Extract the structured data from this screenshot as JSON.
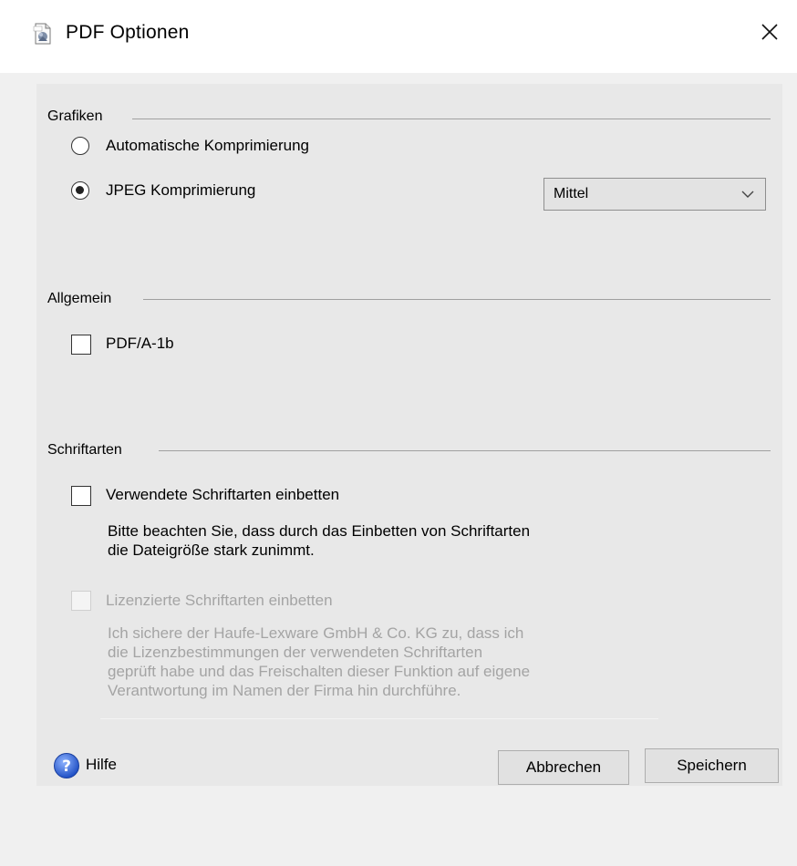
{
  "window": {
    "title": "PDF Optionen",
    "icon": "pdf-document-icon",
    "close_icon": "close-icon"
  },
  "graphics": {
    "title": "Grafiken",
    "options": [
      {
        "label": "Automatische Komprimierung",
        "selected": false
      },
      {
        "label": "JPEG Komprimierung",
        "selected": true
      }
    ],
    "quality_select": {
      "value": "Mittel"
    }
  },
  "general": {
    "title": "Allgemein",
    "pdfa": {
      "label": "PDF/A-1b",
      "checked": false
    }
  },
  "fonts": {
    "title": "Schriftarten",
    "embed": {
      "label": "Verwendete Schriftarten einbetten",
      "checked": false
    },
    "embed_note": [
      "Bitte beachten Sie, dass durch das Einbetten von Schriftarten",
      "die Dateigröße stark zunimmt."
    ],
    "licensed": {
      "label": "Lizenzierte Schriftarten einbetten",
      "checked": false,
      "enabled": false
    },
    "licensed_note": [
      "Ich sichere der Haufe-Lexware GmbH & Co. KG zu, dass ich",
      "die Lizenzbestimmungen der verwendeten Schriftarten",
      "geprüft habe und das Freischalten dieser Funktion auf eigene",
      "Verantwortung im Namen der Firma hin durchführe."
    ]
  },
  "footer": {
    "help_label": "Hilfe",
    "help_icon": "help-icon",
    "cancel_label": "Abbrechen",
    "save_label": "Speichern"
  }
}
